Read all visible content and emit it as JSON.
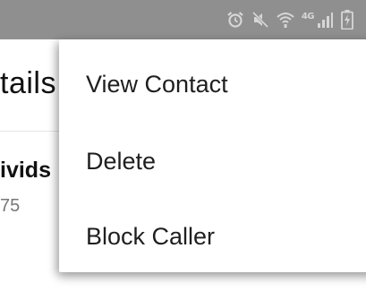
{
  "status_bar": {
    "network_label": "4G",
    "icons": [
      "alarm-icon",
      "mute-icon",
      "wifi-icon",
      "signal-icon",
      "battery-charging-icon"
    ],
    "background_color": "#8f8f8f",
    "icon_color": "#d6d6d6"
  },
  "app": {
    "title": "tails",
    "contact_name": "ivids",
    "contact_detail": "75"
  },
  "menu": {
    "items": [
      {
        "label": "View Contact"
      },
      {
        "label": "Delete"
      },
      {
        "label": "Block Caller"
      }
    ]
  }
}
